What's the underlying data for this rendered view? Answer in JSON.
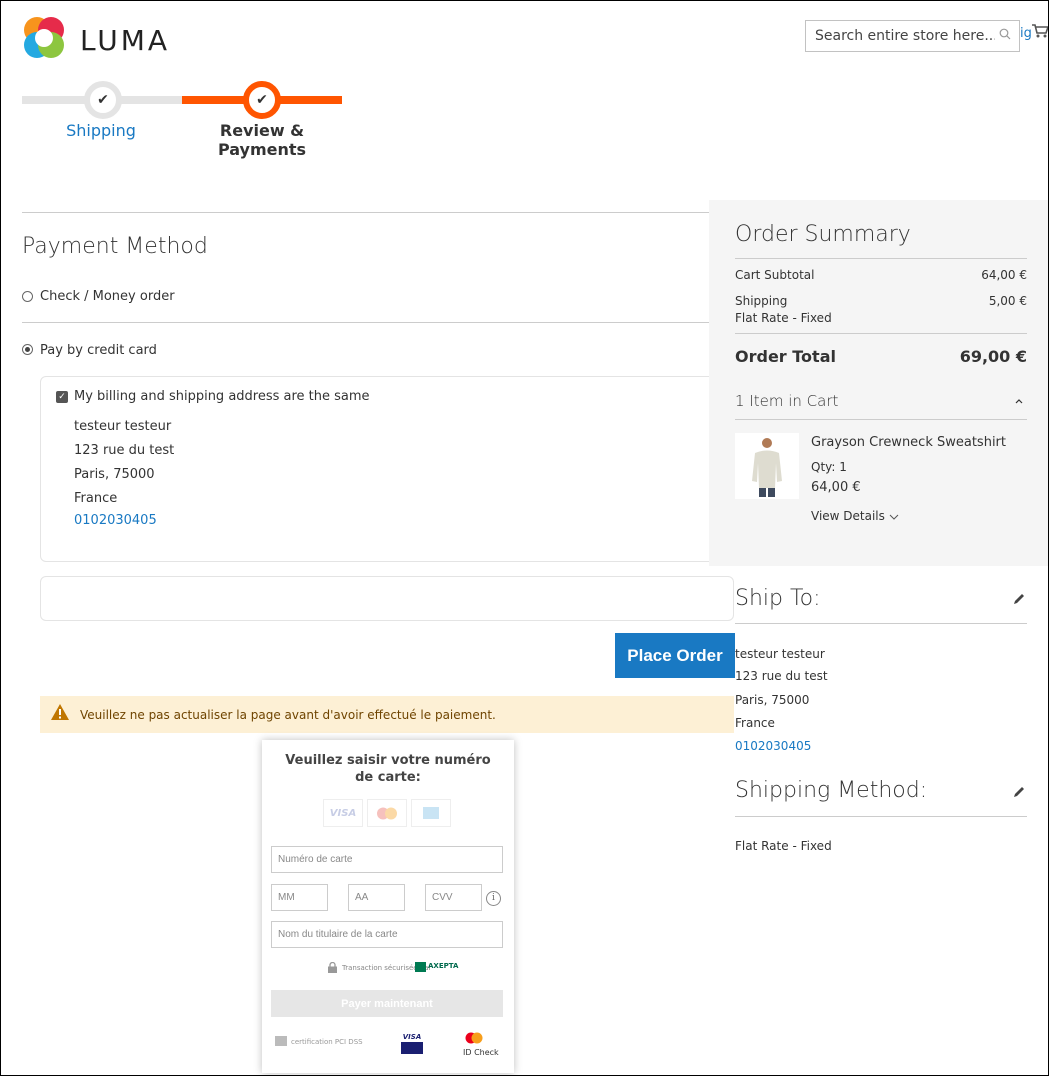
{
  "header": {
    "brand": "LUMA",
    "search_placeholder": "Search entire store here...",
    "signin_label": "ign"
  },
  "progress": {
    "steps": [
      {
        "label": "Shipping",
        "state": "completed"
      },
      {
        "label": "Review & Payments",
        "state": "active"
      }
    ],
    "check_glyph": "✔"
  },
  "payment": {
    "title": "Payment Method",
    "options": [
      {
        "label": "Check / Money order",
        "selected": false
      },
      {
        "label": "Pay by credit card",
        "selected": true
      }
    ],
    "same_address_label": "My billing and shipping address are the same",
    "billing_address": {
      "name": "testeur testeur",
      "street": "123 rue du test",
      "city": "Paris, 75000",
      "country": "France",
      "phone": "0102030405"
    },
    "place_order_label": "Place Order",
    "warning": "Veuillez ne pas actualiser la page avant d'avoir effectué le paiement."
  },
  "card_form": {
    "title": "Veuillez saisir votre numéro de carte:",
    "logos": [
      "VISA",
      "mastercard",
      "amex"
    ],
    "card_number_placeholder": "Numéro de carte",
    "mm_placeholder": "MM",
    "aa_placeholder": "AA",
    "cvv_placeholder": "CVV",
    "info_glyph": "i",
    "holder_placeholder": "Nom du titulaire de la carte",
    "secure_text": "Transaction sécurisée par",
    "axepta_label": "AXEPTA",
    "pay_label": "Payer maintenant",
    "pci_text": "certification PCI DSS",
    "visa_secure_label": "VISA",
    "id_check_label": "ID Check"
  },
  "summary": {
    "title": "Order Summary",
    "subtotal_label": "Cart Subtotal",
    "subtotal_value": "64,00 €",
    "shipping_label": "Shipping",
    "shipping_value": "5,00 €",
    "shipping_method_name": "Flat Rate - Fixed",
    "total_label": "Order Total",
    "total_value": "69,00 €",
    "items_heading": "1 Item in Cart",
    "item": {
      "name": "Grayson Crewneck Sweatshirt",
      "qty": "Qty: 1",
      "price": "64,00 €",
      "details_label": "View Details"
    }
  },
  "ship_to": {
    "title": "Ship To:",
    "name": "testeur testeur",
    "street": "123 rue du test",
    "city": "Paris, 75000",
    "country": "France",
    "phone": "0102030405"
  },
  "shipping_method": {
    "title": "Shipping Method:",
    "value": "Flat Rate - Fixed"
  },
  "colors": {
    "accent_blue": "#1979c3",
    "progress_orange": "#ff5501",
    "summary_bg": "#f5f5f5",
    "warning_bg": "#fdf0d5"
  }
}
